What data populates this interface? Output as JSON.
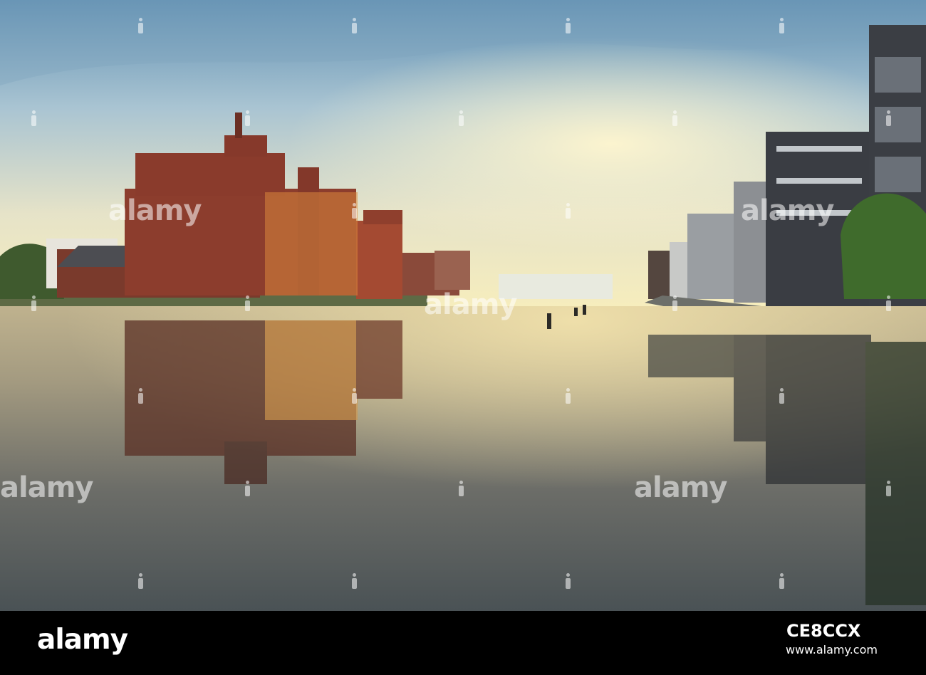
{
  "photo": {
    "subject": "harbour-canal-at-sunset",
    "colors": {
      "sky_top": "#6f98b7",
      "sky_mid": "#b9cfd6",
      "sky_horizon": "#f5eab8",
      "water_light": "#d9cba0",
      "water_dark": "#3f4a4d",
      "brick": "#8a3b2c",
      "modern_building": "#3b3e44"
    }
  },
  "watermark": {
    "text": "alamy",
    "icon": "alamy-i-icon"
  },
  "footer": {
    "logo_text": "alamy",
    "image_id": "CE8CCX",
    "url": "www.alamy.com"
  }
}
